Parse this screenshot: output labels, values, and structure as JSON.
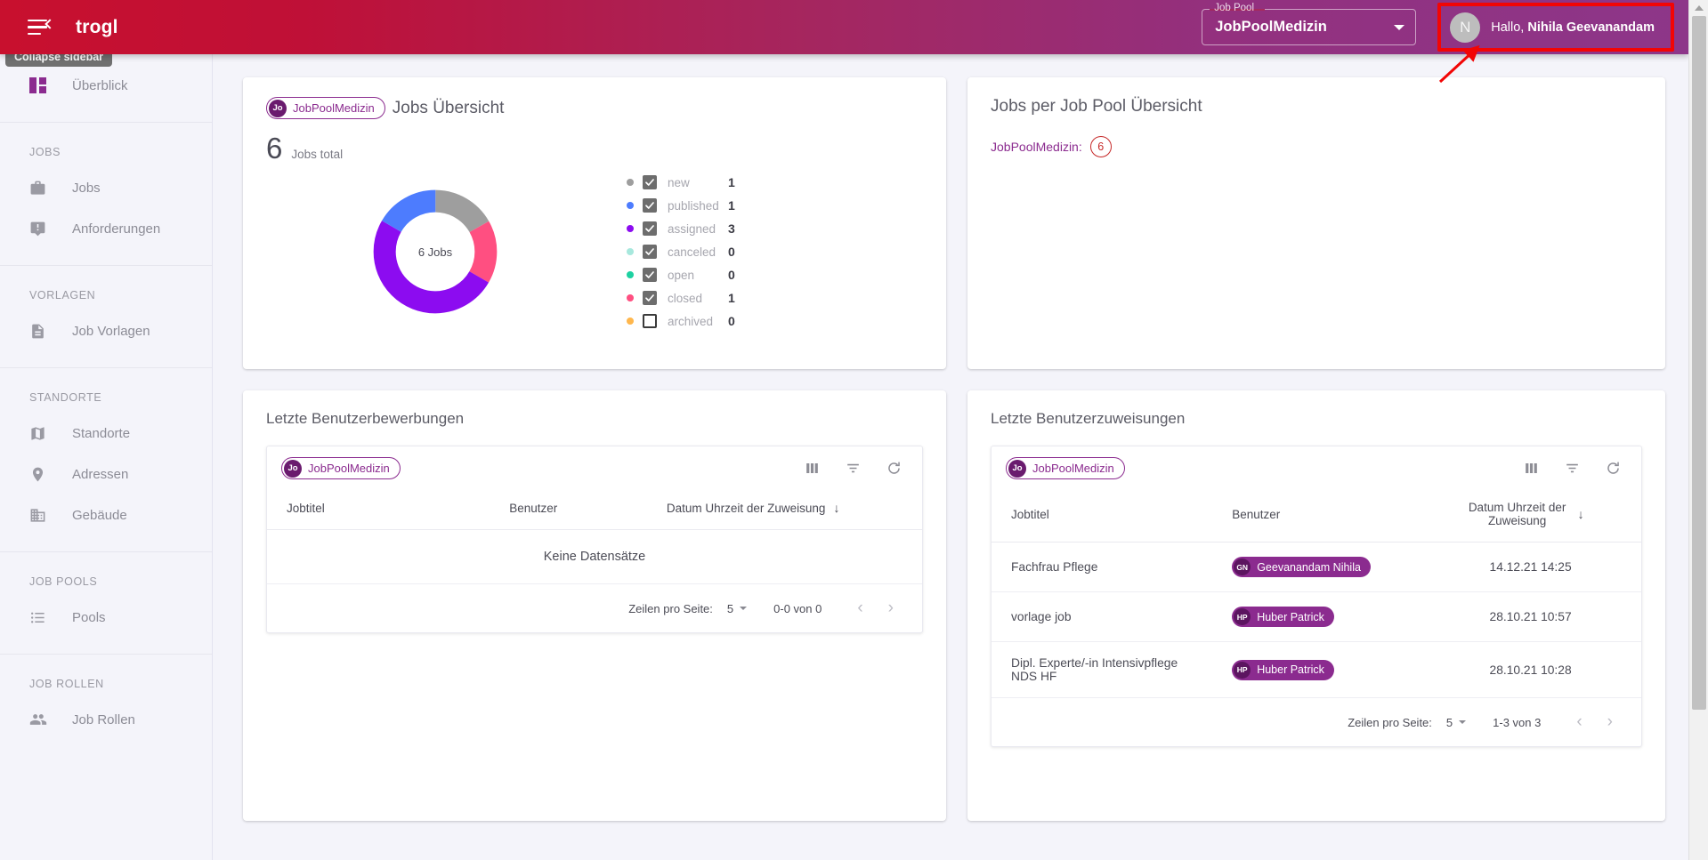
{
  "topbar": {
    "brand": "trogl",
    "menu_icon": "hamburger-collapse-icon",
    "jobpool": {
      "legend": "Job Pool",
      "value": "JobPoolMedizin"
    },
    "user": {
      "avatar_initial": "N",
      "greeting_prefix": "Hallo, ",
      "name": "Nihila Geevanandam"
    }
  },
  "tooltip": {
    "text": "Collapse sidebar"
  },
  "sidebar": {
    "overview": {
      "label": "Überblick",
      "icon": "dashboard-icon"
    },
    "sections": [
      {
        "label": "JOBS",
        "items": [
          {
            "label": "Jobs",
            "icon": "briefcase-icon"
          },
          {
            "label": "Anforderungen",
            "icon": "announcement-icon"
          }
        ]
      },
      {
        "label": "VORLAGEN",
        "items": [
          {
            "label": "Job Vorlagen",
            "icon": "document-icon"
          }
        ]
      },
      {
        "label": "STANDORTE",
        "items": [
          {
            "label": "Standorte",
            "icon": "map-icon"
          },
          {
            "label": "Adressen",
            "icon": "location-pin-icon"
          },
          {
            "label": "Gebäude",
            "icon": "building-icon"
          }
        ]
      },
      {
        "label": "JOB POOLS",
        "items": [
          {
            "label": "Pools",
            "icon": "list-icon"
          }
        ]
      },
      {
        "label": "JOB ROLLEN",
        "items": [
          {
            "label": "Job Rollen",
            "icon": "people-icon"
          }
        ]
      }
    ]
  },
  "jobs_overview": {
    "chip": {
      "avatar": "Jo",
      "label": "JobPoolMedizin"
    },
    "title": "Jobs Übersicht",
    "total_number": "6",
    "total_label": "Jobs total",
    "donut_center": "6 Jobs"
  },
  "jobs_per_pool": {
    "title": "Jobs per Job Pool Übersicht",
    "pool_label": "JobPoolMedizin:",
    "pool_count": "6"
  },
  "applications": {
    "title": "Letzte Benutzerbewerbungen",
    "chip": {
      "avatar": "Jo",
      "label": "JobPoolMedizin"
    },
    "toolbar_icons": [
      "columns-icon",
      "filter-icon",
      "refresh-icon"
    ],
    "columns": [
      "Jobtitel",
      "Benutzer",
      "Datum Uhrzeit der Zuweisung"
    ],
    "sort_icon": "arrow-down-icon",
    "empty_text": "Keine Datensätze",
    "rows": [],
    "paginator": {
      "rows_per_page_label": "Zeilen pro Seite:",
      "rows_per_page_value": "5",
      "range": "0-0 von 0",
      "prev_icon": "chevron-left-icon",
      "next_icon": "chevron-right-icon"
    }
  },
  "assignments": {
    "title": "Letzte Benutzerzuweisungen",
    "chip": {
      "avatar": "Jo",
      "label": "JobPoolMedizin"
    },
    "toolbar_icons": [
      "columns-icon",
      "filter-icon",
      "refresh-icon"
    ],
    "columns": [
      "Jobtitel",
      "Benutzer",
      "Datum Uhrzeit der Zuweisung"
    ],
    "sort_icon": "arrow-down-icon",
    "rows": [
      {
        "jobtitel": "Fachfrau Pflege",
        "user_initials": "GN",
        "user": "Geevanandam Nihila",
        "datum": "14.12.21 14:25"
      },
      {
        "jobtitel": "vorlage job",
        "user_initials": "HP",
        "user": "Huber Patrick",
        "datum": "28.10.21 10:57"
      },
      {
        "jobtitel": "Dipl. Experte/-in Intensivpflege NDS HF",
        "user_initials": "HP",
        "user": "Huber Patrick",
        "datum": "28.10.21 10:28"
      }
    ],
    "paginator": {
      "rows_per_page_label": "Zeilen pro Seite:",
      "rows_per_page_value": "5",
      "range": "1-3 von 3",
      "prev_icon": "chevron-left-icon",
      "next_icon": "chevron-right-icon"
    }
  },
  "annotation": {
    "highlight_color": "#f20505",
    "arrow": "red-pointer-arrow"
  },
  "chart_data": {
    "type": "pie",
    "title": "Jobs Übersicht",
    "center_label": "6 Jobs",
    "total": 6,
    "categories": [
      "new",
      "published",
      "assigned",
      "canceled",
      "open",
      "closed",
      "archived"
    ],
    "values": [
      1,
      1,
      3,
      0,
      0,
      1,
      0
    ],
    "colors": [
      "#9e9e9e",
      "#4d7cfe",
      "#8c0cf0",
      "#a7e8dd",
      "#1dd1a1",
      "#ff4f81",
      "#ffb74d"
    ],
    "checked": [
      true,
      true,
      true,
      true,
      true,
      true,
      false
    ],
    "legend_position": "right",
    "donut": true
  }
}
